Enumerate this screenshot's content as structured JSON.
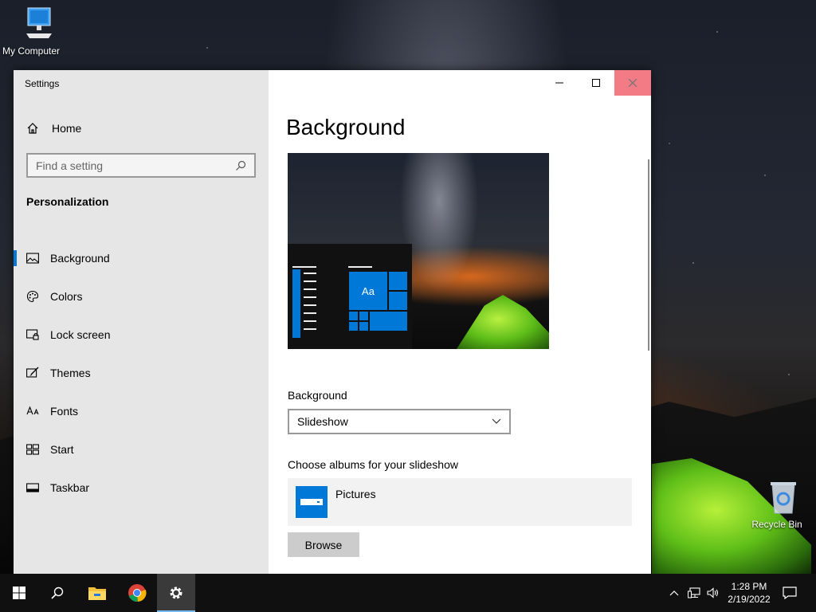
{
  "desktop": {
    "icons": {
      "my_computer": "My Computer",
      "recycle_bin": "Recycle Bin"
    }
  },
  "window": {
    "title": "Settings",
    "controls": {
      "minimize": "minimize-icon",
      "maximize": "maximize-icon",
      "close": "close-icon"
    }
  },
  "sidebar": {
    "home_label": "Home",
    "search_placeholder": "Find a setting",
    "section_heading": "Personalization",
    "items": [
      {
        "label": "Background",
        "icon": "picture-icon",
        "active": true
      },
      {
        "label": "Colors",
        "icon": "palette-icon",
        "active": false
      },
      {
        "label": "Lock screen",
        "icon": "lock-screen-icon",
        "active": false
      },
      {
        "label": "Themes",
        "icon": "brush-icon",
        "active": false
      },
      {
        "label": "Fonts",
        "icon": "font-icon",
        "active": false
      },
      {
        "label": "Start",
        "icon": "start-grid-icon",
        "active": false
      },
      {
        "label": "Taskbar",
        "icon": "taskbar-icon",
        "active": false
      }
    ]
  },
  "main": {
    "title": "Background",
    "preview_tile_text": "Aa",
    "background_label": "Background",
    "background_value": "Slideshow",
    "albums_label": "Choose albums for your slideshow",
    "album_name": "Pictures",
    "browse_label": "Browse"
  },
  "taskbar": {
    "time": "1:28 PM",
    "date": "2/19/2022"
  },
  "colors": {
    "accent": "#0078d7",
    "sidebar_bg": "#e6e6e6",
    "close_hover": "#e81123",
    "taskbar_bg": "#101010"
  }
}
